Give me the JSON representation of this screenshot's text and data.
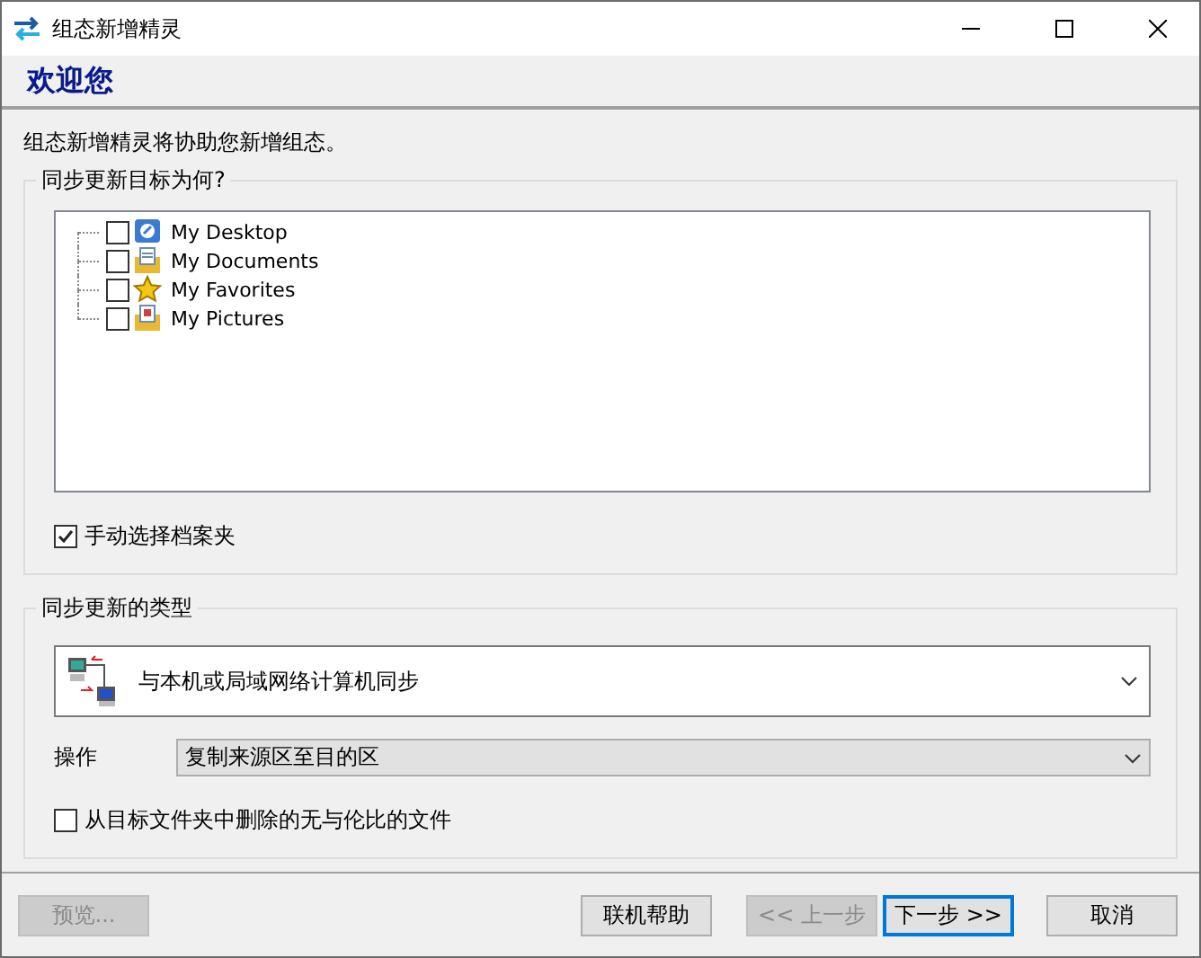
{
  "window": {
    "title": "组态新增精灵"
  },
  "header": {
    "title": "欢迎您"
  },
  "intro": "组态新增精灵将协助您新增组态。",
  "targets": {
    "legend": "同步更新目标为何?",
    "items": [
      {
        "label": "My Desktop",
        "checked": false,
        "kind": "desktop"
      },
      {
        "label": "My Documents",
        "checked": false,
        "kind": "documents"
      },
      {
        "label": "My Favorites",
        "checked": false,
        "kind": "favorites"
      },
      {
        "label": "My Pictures",
        "checked": false,
        "kind": "pictures"
      }
    ],
    "manual_select": {
      "label": "手动选择档案夹",
      "checked": true
    }
  },
  "sync_type": {
    "legend": "同步更新的类型",
    "mode": "与本机或局域网络计算机同步",
    "operation_label": "操作",
    "operation": "复制来源区至目的区",
    "delete_unmatched": {
      "label": "从目标文件夹中删除的无与伦比的文件",
      "checked": false
    }
  },
  "buttons": [
    {
      "label": "预览...",
      "disabled": true,
      "default": false
    },
    {
      "label": "联机帮助",
      "disabled": false,
      "default": false
    },
    {
      "label": "<< 上一步",
      "disabled": true,
      "default": false
    },
    {
      "label": "下一步 >>",
      "disabled": false,
      "default": true
    },
    {
      "label": "取消",
      "disabled": false,
      "default": false
    }
  ]
}
